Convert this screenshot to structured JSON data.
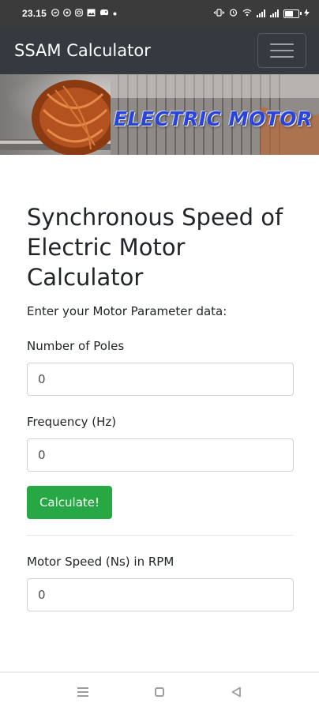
{
  "status_bar": {
    "time": "23.15",
    "left_icons": [
      "messenger-icon",
      "whatsapp-icon",
      "instagram-icon",
      "photo-icon",
      "game-icon",
      "dot-icon"
    ],
    "right_icons": [
      "vibrate-icon",
      "alarm-icon",
      "wifi-icon",
      "signal-icon",
      "signal-icon",
      "battery-icon"
    ]
  },
  "navbar": {
    "brand": "SSAM Calculator",
    "toggle_icon": "hamburger-icon"
  },
  "banner": {
    "text": "ELECTRIC MOTOR"
  },
  "main": {
    "title": "Synchronous Speed of Electric Motor Calculator",
    "intro": "Enter your Motor Parameter data:",
    "fields": [
      {
        "label": "Number of Poles",
        "value": "0"
      },
      {
        "label": "Frequency (Hz)",
        "value": "0"
      }
    ],
    "button_label": "Calculate!",
    "result": {
      "label": "Motor Speed (Ns) in RPM",
      "value": "0"
    }
  },
  "colors": {
    "navbar": "#343a40",
    "button": "#28a745",
    "banner_text": "#2a43d8"
  },
  "bottom_nav": {
    "icons": [
      "menu-icon",
      "home-icon",
      "back-icon"
    ]
  }
}
